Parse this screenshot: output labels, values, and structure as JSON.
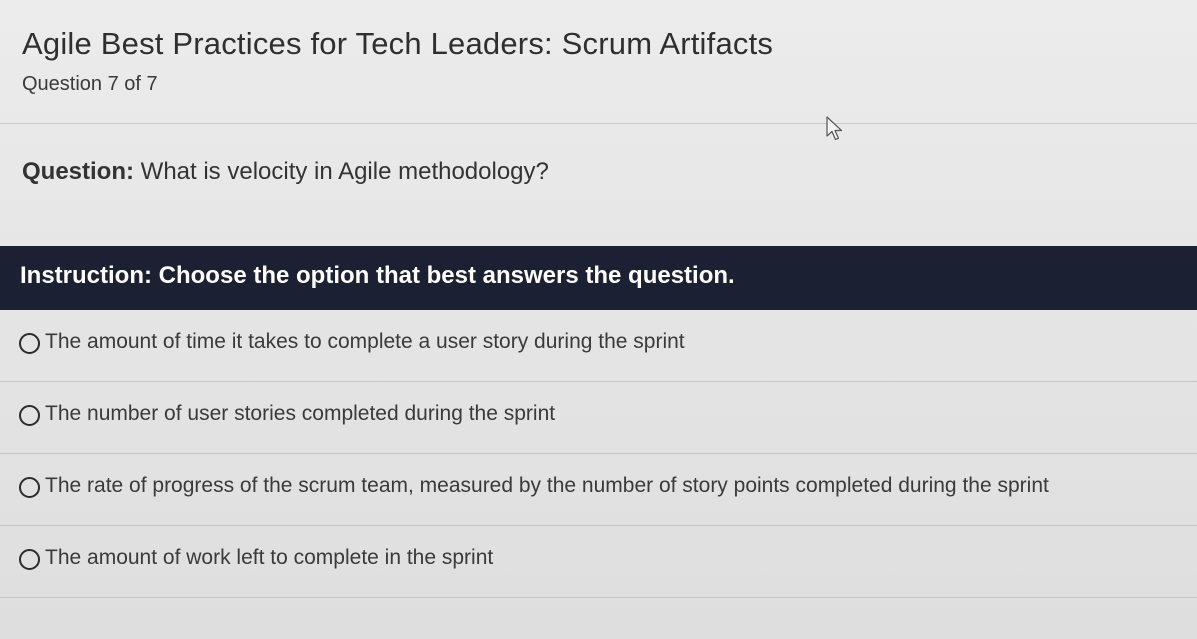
{
  "quiz": {
    "title": "Agile Best Practices for Tech Leaders: Scrum Artifacts",
    "counter": "Question 7 of 7"
  },
  "question": {
    "label": "Question:",
    "text": " What is velocity in Agile methodology?"
  },
  "instruction": {
    "text": "Instruction: Choose the option that best answers the question."
  },
  "options": [
    {
      "label": "The amount of time it takes to complete a user story during the sprint",
      "selected": false
    },
    {
      "label": "The number of user stories completed during the sprint",
      "selected": false
    },
    {
      "label": "The rate of progress of the scrum team, measured by the number of story points completed during the sprint",
      "selected": false
    },
    {
      "label": "The amount of work left to complete in the sprint",
      "selected": false
    }
  ],
  "colors": {
    "instruction_bar": "#1c2033",
    "background": "#e6e6e6",
    "text": "#3a3a3a"
  },
  "icons": {
    "cursor": "mouse-pointer-icon",
    "radio": "radio-unchecked-icon"
  }
}
